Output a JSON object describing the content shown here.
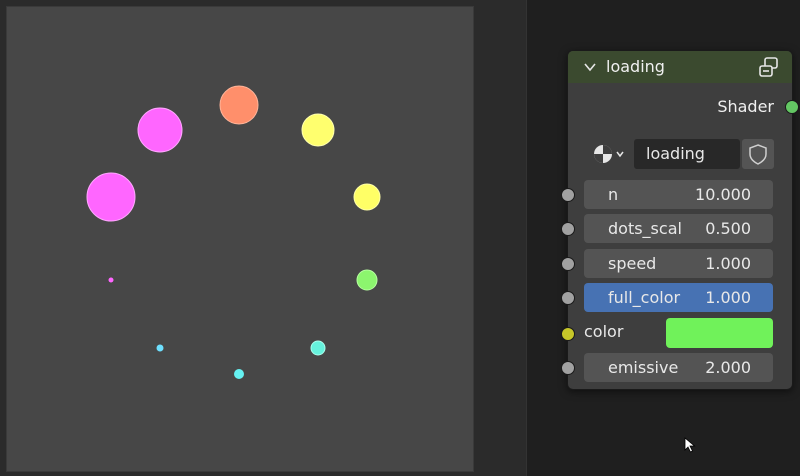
{
  "node": {
    "title": "loading",
    "output_label": "Shader",
    "group_name": "loading",
    "inputs": [
      {
        "label": "n",
        "value": "10.000"
      },
      {
        "label": "dots_scal",
        "value": "0.500"
      },
      {
        "label": "speed",
        "value": "1.000"
      },
      {
        "label": "full_color",
        "value": "1.000"
      }
    ],
    "color_label": "color",
    "color_value": "#70f25a",
    "emissive": {
      "label": "emissive",
      "value": "2.000"
    }
  },
  "colors": {
    "header": "#3b4a2f",
    "active_field": "#4772b3",
    "shader_socket": "#63c763"
  },
  "icons": {
    "collapse": "chevron-down-icon",
    "node_group": "node-group-icon",
    "material_sphere": "material-sphere-icon",
    "fake_user": "shield-icon",
    "pointer": "mouse-cursor-icon"
  }
}
